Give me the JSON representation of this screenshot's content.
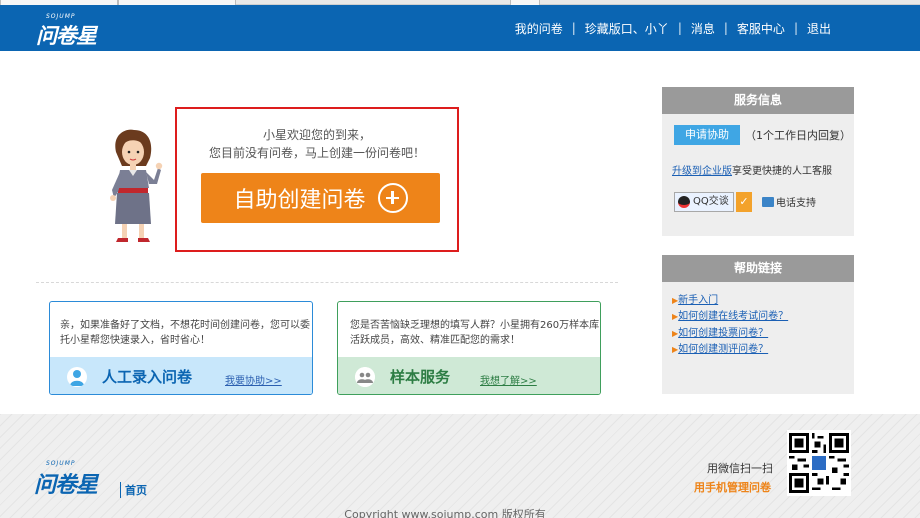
{
  "header": {
    "logo_en": "SOJUMP",
    "logo_cn": "问卷星",
    "nav": [
      "我的问卷",
      "珍藏版口、小丫",
      "消息",
      "客服中心",
      "退出"
    ]
  },
  "welcome": {
    "line1": "小星欢迎您的到来，",
    "line2": "您目前没有问卷，马上创建一份问卷吧！",
    "button": "自助创建问卷"
  },
  "cards": [
    {
      "text": "亲，如果准备好了文档，不想花时间创建问卷，您可以委托小星帮您快速录入，省时省心！",
      "title": "人工录入问卷",
      "link": "我要协助>>",
      "icon": "person-icon",
      "color": "#0b65b2"
    },
    {
      "text": "您是否苦恼缺乏理想的填写人群？小星拥有260万样本库活跃成员，高效、精准匹配您的需求！",
      "title": "样本服务",
      "link": "我想了解>>",
      "icon": "group-icon",
      "color": "#2d7d44"
    }
  ],
  "service": {
    "title": "服务信息",
    "apply": "申请协助",
    "apply_note": "（1个工作日内回复）",
    "upgrade_link": "升级到企业版",
    "upgrade_rest": "享受更快捷的人工客服",
    "qq": "QQ交谈",
    "phone": "电话支持"
  },
  "help": {
    "title": "帮助链接",
    "links": [
      "新手入门",
      "如何创建在线考试问卷？",
      "如何创建投票问卷？",
      "如何创建测评问卷？"
    ]
  },
  "footer": {
    "logo_en": "SOJUMP",
    "logo_cn": "问卷星",
    "home": "首页",
    "wx1": "用微信扫一扫",
    "wx2": "用手机管理问卷",
    "copyright": "Copyright  www.sojump.com  版权所有"
  }
}
